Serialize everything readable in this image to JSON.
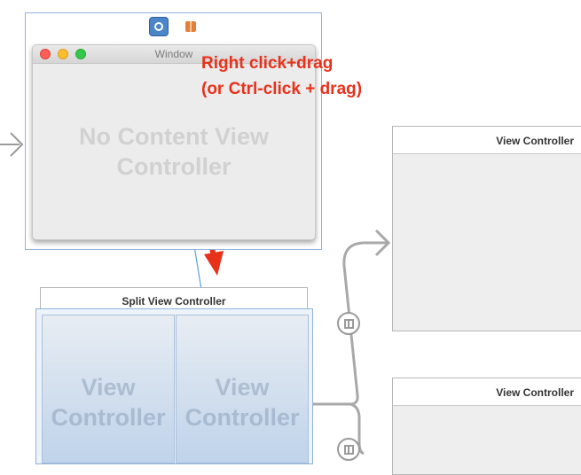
{
  "window_scene": {
    "window_title": "Window",
    "placeholder": [
      "No Content View",
      "Controller"
    ]
  },
  "annotation": {
    "line1": "Right click+drag",
    "line2": "(or Ctrl-click + drag)",
    "color": "#e8311a"
  },
  "split_scene": {
    "title": "Split View Controller",
    "left_pane": [
      "View",
      "Controller"
    ],
    "right_pane": [
      "View",
      "Controller"
    ]
  },
  "view_controllers": [
    {
      "title": "View Controller"
    },
    {
      "title": "View Controller"
    }
  ],
  "icons": {
    "window_controller": "window-controller-icon",
    "first_responder": "first-responder-cube-icon",
    "relationship": "split-view-relationship-icon",
    "entry_arrow": "entry-point-arrow-icon"
  },
  "colors": {
    "selection_blue": "#8fb3d9",
    "connection_line": "#5aa2e0",
    "segue_gray": "#9a9a9a"
  }
}
